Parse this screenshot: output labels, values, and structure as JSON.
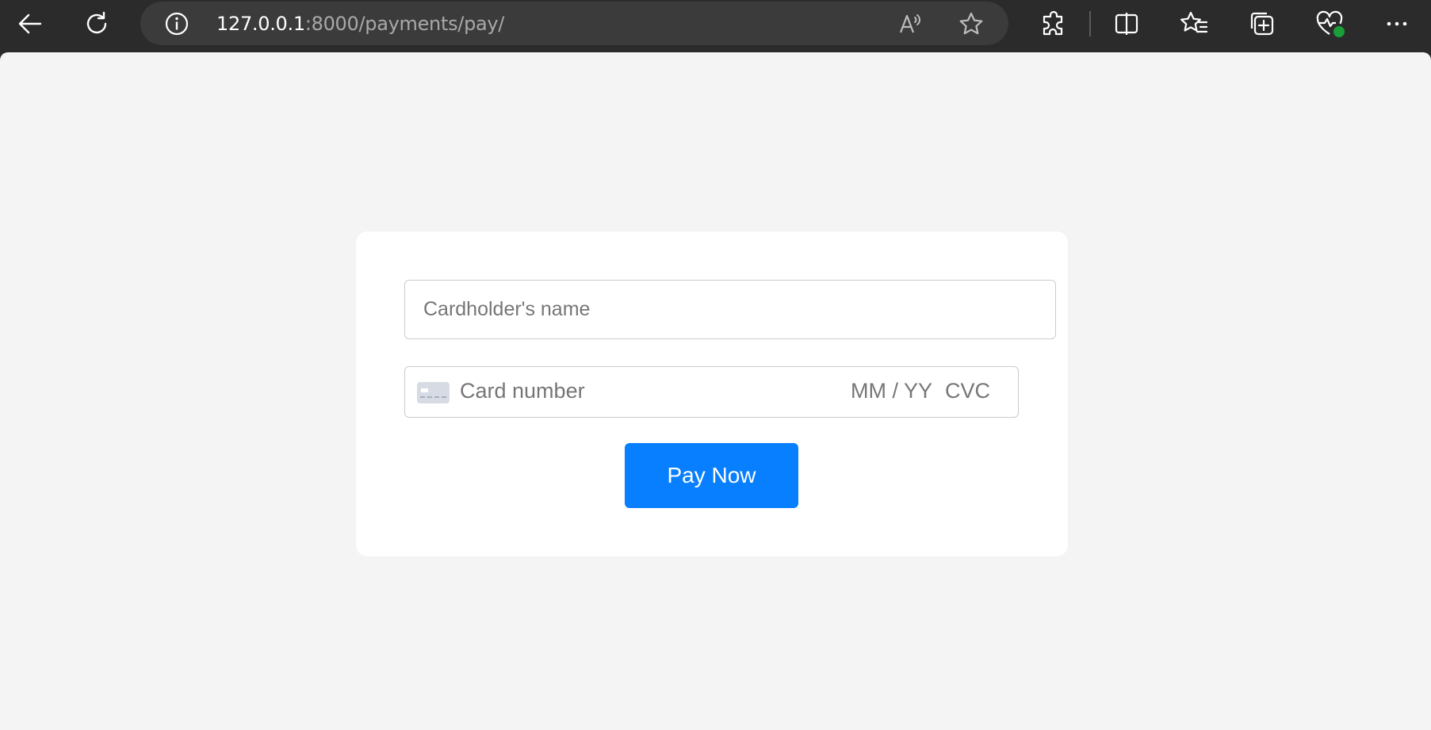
{
  "browser": {
    "url_host": "127.0.0.1",
    "url_path": ":8000/payments/pay/",
    "icons": [
      "back-arrow-icon",
      "refresh-icon",
      "site-info-icon",
      "read-aloud-icon",
      "favorite-star-icon",
      "extensions-icon",
      "split-screen-icon",
      "favorites-list-icon",
      "collections-icon",
      "browser-essentials-icon",
      "more-options-icon"
    ]
  },
  "payment_form": {
    "name_placeholder": "Cardholder's name",
    "card_number_placeholder": "Card number",
    "expiry_placeholder": "MM / YY",
    "cvc_placeholder": "CVC",
    "submit_label": "Pay Now"
  },
  "colors": {
    "accent": "#087ffe",
    "page_background": "#f4f4f4",
    "chrome_background": "#2b2b2b",
    "status_dot": "#1a9e3a"
  }
}
